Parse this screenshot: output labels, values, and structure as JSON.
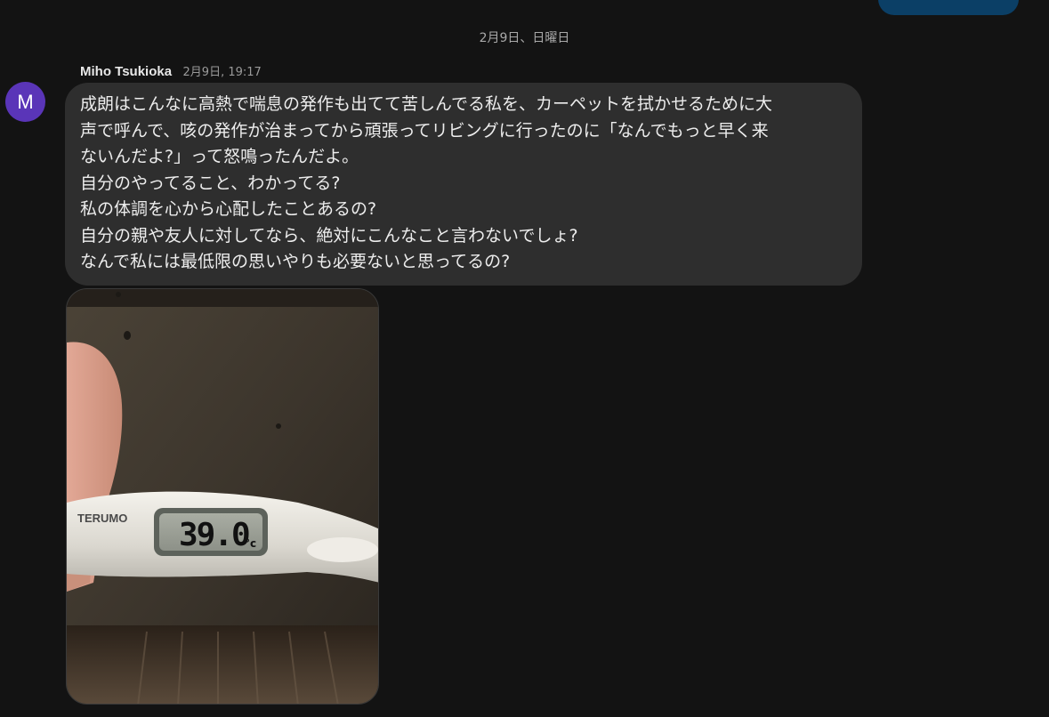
{
  "date_separator": "2月9日、日曜日",
  "message": {
    "avatar_letter": "M",
    "sender": "Miho Tsukioka",
    "timestamp": "2月9日, 19:17",
    "lines": [
      "成朗はこんなに高熱で喘息の発作も出てて苦しんでる私を、カーペットを拭かせるために大",
      "声で呼んで、咳の発作が治まってから頑張ってリビングに行ったのに「なんでもっと早く来",
      "ないんだよ?」って怒鳴ったんだよ。",
      "自分のやってること、わかってる?",
      "私の体調を心から心配したことあるの?",
      "自分の親や友人に対してなら、絶対にこんなこと言わないでしょ?",
      "なんで私には最低限の思いやりも必要ないと思ってるの?"
    ]
  },
  "photo": {
    "thermometer_brand": "TERUMO",
    "thermometer_reading": "39.0",
    "thermometer_unit": "°c"
  },
  "colors": {
    "background": "#131313",
    "bubble": "#2e2e2e",
    "avatar": "#5a35b8",
    "previous_bubble": "#0b3f66"
  }
}
